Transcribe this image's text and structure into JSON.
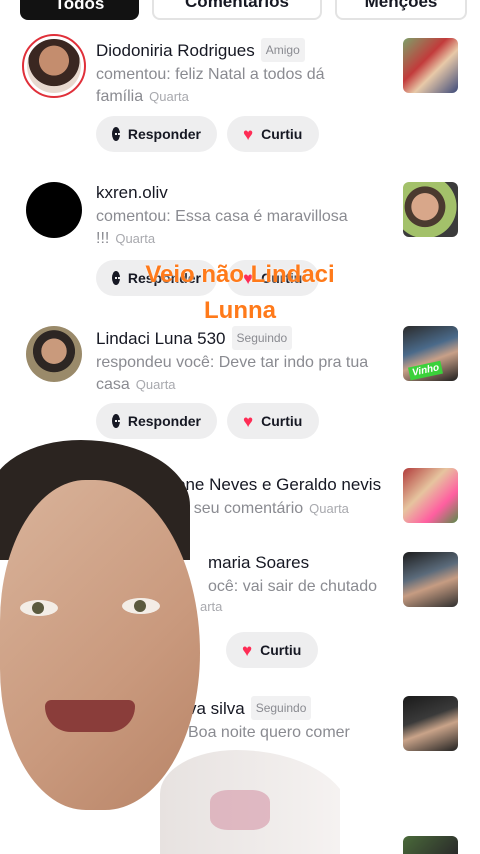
{
  "tabs": [
    {
      "label": "Todos",
      "active": true
    },
    {
      "label": "Comentários",
      "active": false
    },
    {
      "label": "Menções",
      "active": false
    }
  ],
  "overlay_caption": {
    "line1": "Veio não Lindaci",
    "line2": "Lunna"
  },
  "actions": {
    "reply_label": "Responder",
    "like_label": "Curtiu"
  },
  "notifications": [
    {
      "name": "Diodoniria Rodrigues",
      "badge": "Amigo",
      "text": "comentou: feliz Natal a todos dá família",
      "time": "Quarta"
    },
    {
      "name": "kxren.oliv",
      "badge": "",
      "text": "comentou: Essa casa é maravillosa !!!",
      "time": "Quarta"
    },
    {
      "name": "Lindaci Luna 530",
      "badge": "Seguindo",
      "text": "respondeu você: Deve tar indo pra tua casa",
      "time": "Quarta"
    },
    {
      "name": "one Neves e Geraldo nevis",
      "badge": "",
      "text": "m seu comentário",
      "time": "Quarta"
    },
    {
      "name": "maria Soares",
      "badge": "",
      "text": "ocê: vai sair de chutado",
      "time": "arta"
    },
    {
      "name": "va silva",
      "badge": "Seguindo",
      "text": "Boa noite quero comer",
      "time": ""
    }
  ],
  "colors": {
    "active_tab": "#121212",
    "caption": "#ff7a1a",
    "heart": "#fe2c55",
    "button_bg": "#eeeeef",
    "secondary_text": "#8a8b91"
  },
  "thumbnail_text": "Vinho"
}
